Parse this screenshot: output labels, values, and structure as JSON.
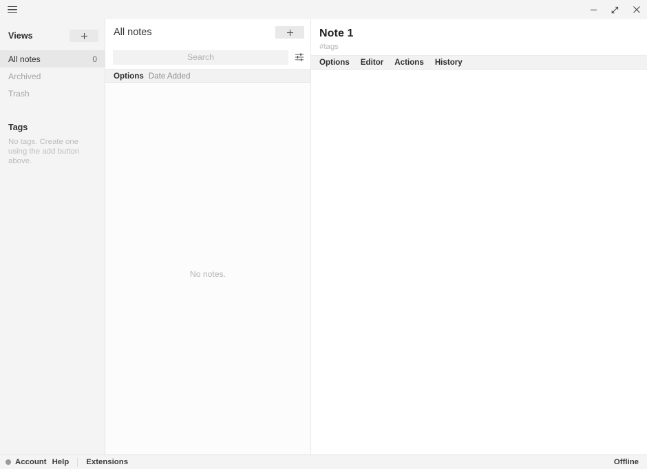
{
  "titlebar": {
    "menu_icon": "hamburger-icon",
    "minimize_label": "–",
    "maximize_label": "maximize-icon",
    "close_label": "×"
  },
  "sidebar": {
    "views_header": "Views",
    "add_view_label": "+",
    "items": [
      {
        "label": "All notes",
        "count": "0",
        "selected": true
      },
      {
        "label": "Archived",
        "count": "",
        "selected": false
      },
      {
        "label": "Trash",
        "count": "",
        "selected": false
      }
    ],
    "tags_header": "Tags",
    "tags_empty": "No tags. Create one using the add button above."
  },
  "notes": {
    "title": "All notes",
    "add_note_label": "+",
    "search_placeholder": "Search",
    "search_value": "",
    "filter_icon": "sliders-icon",
    "options_label": "Options",
    "sort_label": "Date Added",
    "empty_message": "No notes."
  },
  "note": {
    "title": "Note 1",
    "tags_placeholder": "#tags",
    "tabs": [
      {
        "label": "Options"
      },
      {
        "label": "Editor"
      },
      {
        "label": "Actions"
      },
      {
        "label": "History"
      }
    ]
  },
  "status": {
    "account_label": "Account",
    "help_label": "Help",
    "extensions_label": "Extensions",
    "connection_label": "Offline"
  }
}
